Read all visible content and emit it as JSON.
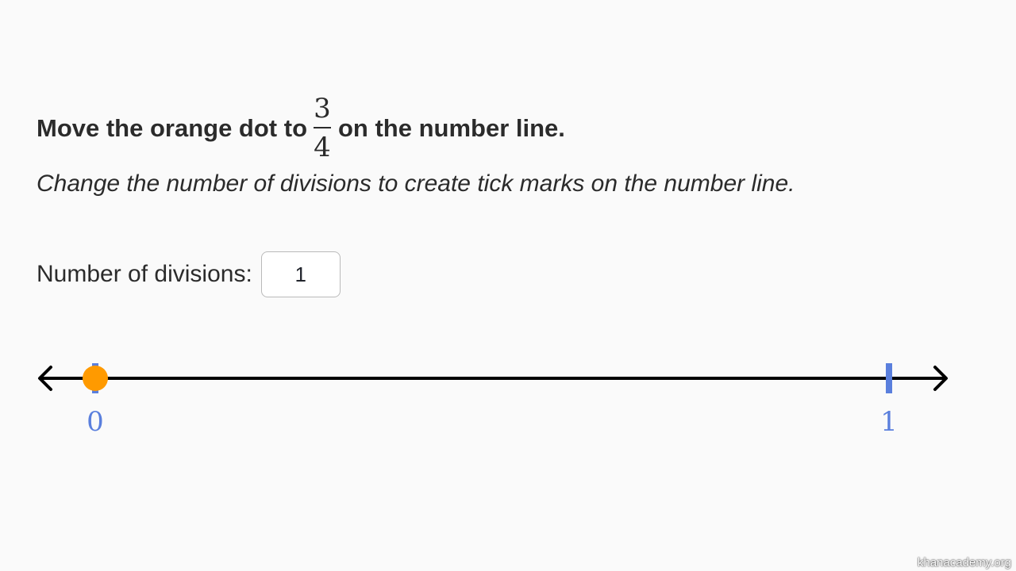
{
  "prompt": {
    "before": "Move the orange dot to",
    "fraction": {
      "numerator": "3",
      "denominator": "4"
    },
    "after": "on the number line."
  },
  "instruction": "Change the number of divisions to create tick marks on the number line.",
  "divisions": {
    "label": "Number of divisions:",
    "value": "1"
  },
  "number_line": {
    "min": 0,
    "max": 1,
    "divisions": 1,
    "tick_labels": [
      "0",
      "1"
    ],
    "dot_value": 0,
    "colors": {
      "line": "#000000",
      "tick": "#5a7fdd",
      "dot": "#ff9a00"
    }
  },
  "watermark": "khanacademy.org"
}
